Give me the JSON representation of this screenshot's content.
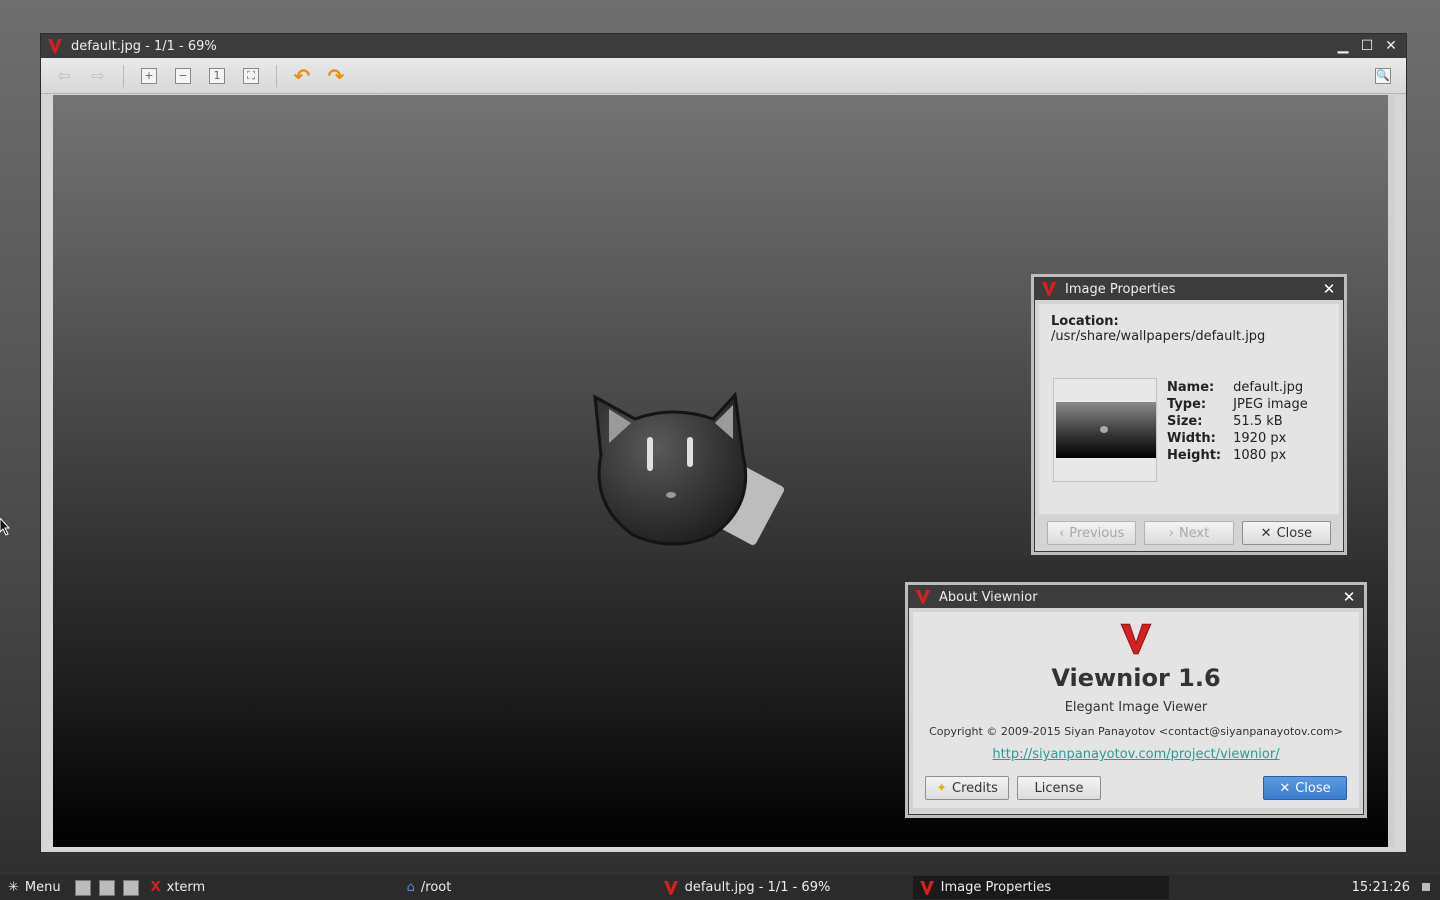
{
  "viewer": {
    "title": "default.jpg - 1/1 - 69%",
    "toolbar": {
      "back": "back-arrow-icon",
      "forward": "forward-arrow-icon",
      "zoom_in": "+",
      "zoom_out": "−",
      "zoom_normal": "1",
      "zoom_fit": "fit",
      "rotate_left": "↶",
      "rotate_right": "↷"
    }
  },
  "properties": {
    "title": "Image Properties",
    "location_label": "Location:",
    "location_value": "/usr/share/wallpapers/default.jpg",
    "fields": [
      {
        "k": "Name:",
        "v": "default.jpg"
      },
      {
        "k": "Type:",
        "v": "JPEG image"
      },
      {
        "k": "Size:",
        "v": "51.5 kB"
      },
      {
        "k": "Width:",
        "v": "1920 px"
      },
      {
        "k": "Height:",
        "v": "1080 px"
      }
    ],
    "previous": "Previous",
    "next": "Next",
    "close": "Close"
  },
  "about": {
    "title": "About Viewnior",
    "app_name": "Viewnior 1.6",
    "subtitle": "Elegant Image Viewer",
    "copyright": "Copyright © 2009-2015 Siyan Panayotov <contact@siyanpanayotov.com>",
    "url": "http://siyanpanayotov.com/project/viewnior/",
    "credits": "Credits",
    "license": "License",
    "close": "Close"
  },
  "taskbar": {
    "menu": "Menu",
    "tasks": [
      {
        "label": "xterm"
      },
      {
        "label": "/root"
      },
      {
        "label": "default.jpg - 1/1 - 69%"
      },
      {
        "label": "Image Properties"
      }
    ],
    "clock": "15:21:26"
  },
  "colors": {
    "accent": "#e8900c",
    "logo_red": "#d42020",
    "link": "#2a9a9a",
    "primary_button": "#3a7bd0"
  }
}
